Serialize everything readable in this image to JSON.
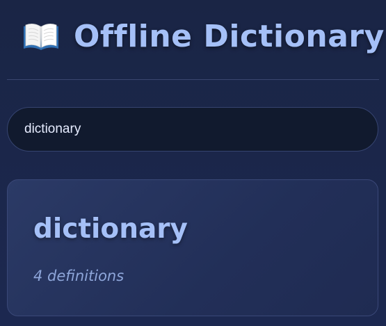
{
  "app": {
    "title": "Offline Dictionary",
    "icon": "open-book-icon"
  },
  "search": {
    "value": "dictionary"
  },
  "result": {
    "word": "dictionary",
    "definitions_label": "4 definitions"
  },
  "colors": {
    "accent": "#a5c0f7",
    "background": "#1b2648",
    "card": "#27355f"
  }
}
